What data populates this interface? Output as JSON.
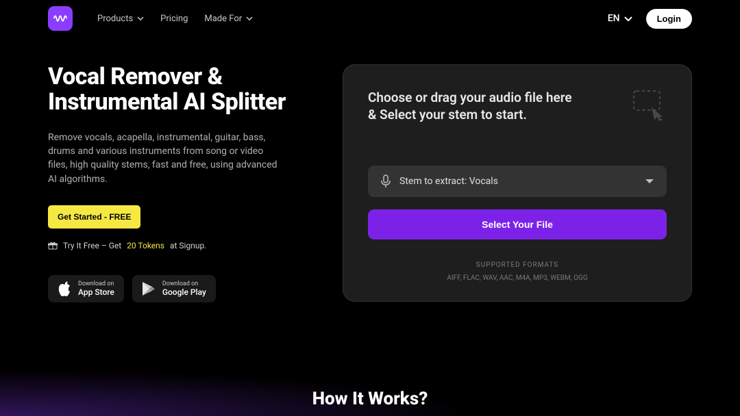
{
  "nav": {
    "products": "Products",
    "pricing": "Pricing",
    "madeFor": "Made For"
  },
  "header": {
    "lang": "EN",
    "login": "Login"
  },
  "hero": {
    "title": "Vocal Remover & Instrumental AI Splitter",
    "desc": "Remove vocals, acapella, instrumental, guitar, bass, drums and various instruments from song or video files, high quality stems, fast and free, using advanced AI algorithms.",
    "cta": "Get Started - FREE",
    "trialPrefix": "Try It Free – Get",
    "trialTokens": "20 Tokens",
    "trialSuffix": "at Signup."
  },
  "stores": {
    "appStore": {
      "small": "Download on",
      "big": "App Store"
    },
    "googlePlay": {
      "small": "Download on",
      "big": "Google Play"
    }
  },
  "panel": {
    "title": "Choose or drag your audio file here & Select your stem to start.",
    "stemLabel": "Stem to extract: Vocals",
    "selectFile": "Select Your File",
    "formatsLabel": "SUPPORTED FORMATS",
    "formatsList": "AIFF, FLAC, WAV, AAC, M4A, MP3, WEBM, OGG"
  },
  "bottom": {
    "howItWorks": "How It Works?"
  }
}
